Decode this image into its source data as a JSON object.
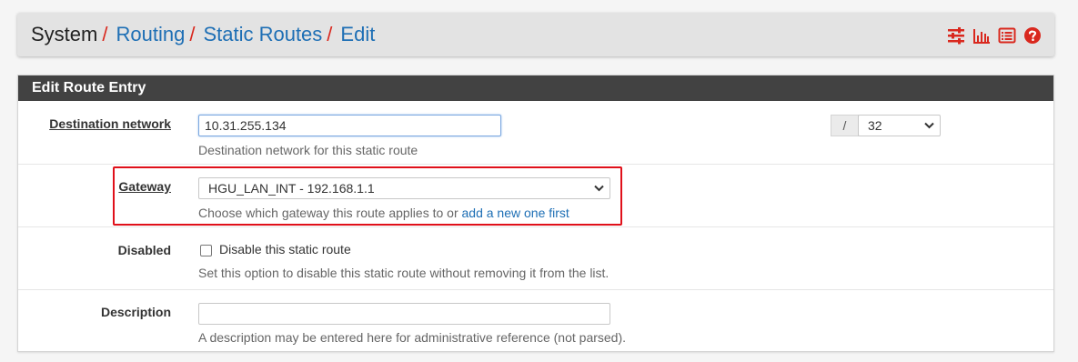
{
  "breadcrumb": {
    "items": [
      "System",
      "Routing",
      "Static Routes",
      "Edit"
    ],
    "separator": "/"
  },
  "header_icons": [
    "sliders-icon",
    "bar-chart-icon",
    "list-icon",
    "help-icon"
  ],
  "panel": {
    "title": "Edit Route Entry"
  },
  "form": {
    "destination": {
      "label": "Destination network",
      "value": "10.31.255.134",
      "help": "Destination network for this static route",
      "slash": "/",
      "mask": "32"
    },
    "gateway": {
      "label": "Gateway",
      "selected": "HGU_LAN_INT - 192.168.1.1",
      "help_prefix": "Choose which gateway this route applies to or ",
      "help_link": "add a new one first"
    },
    "disabled": {
      "label": "Disabled",
      "checkbox_label": "Disable this static route",
      "checked": false,
      "help": "Set this option to disable this static route without removing it from the list."
    },
    "description": {
      "label": "Description",
      "value": "",
      "help": "A description may be entered here for administrative reference (not parsed)."
    }
  },
  "colors": {
    "accent_red": "#d9281e",
    "link_blue": "#1e6fb5",
    "panel_header": "#424242",
    "highlight_border": "#e0101a"
  }
}
